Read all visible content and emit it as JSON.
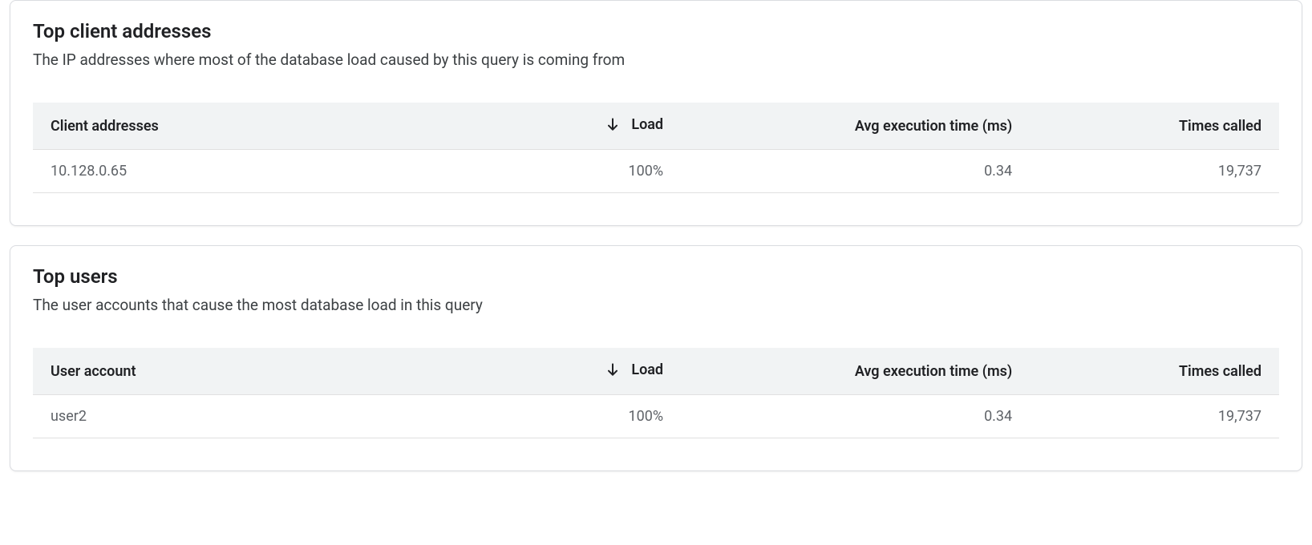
{
  "clients": {
    "title": "Top client addresses",
    "subtitle": "The IP addresses where most of the database load caused by this query is coming from",
    "columns": {
      "address": "Client addresses",
      "load": "Load",
      "avg": "Avg execution time (ms)",
      "times": "Times called"
    },
    "rows": [
      {
        "address": "10.128.0.65",
        "load": "100%",
        "avg": "0.34",
        "times": "19,737"
      }
    ]
  },
  "users": {
    "title": "Top users",
    "subtitle": "The user accounts that cause the most database load in this query",
    "columns": {
      "user": "User account",
      "load": "Load",
      "avg": "Avg execution time (ms)",
      "times": "Times called"
    },
    "rows": [
      {
        "user": "user2",
        "load": "100%",
        "avg": "0.34",
        "times": "19,737"
      }
    ]
  }
}
